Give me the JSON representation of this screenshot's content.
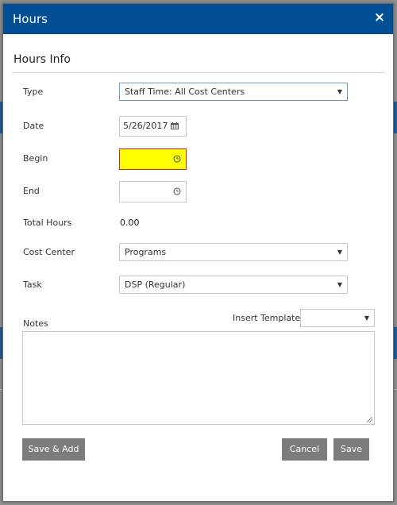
{
  "modal": {
    "title": "Hours",
    "close_label": "×",
    "section_title": "Hours Info"
  },
  "form": {
    "type": {
      "label": "Type",
      "value": "Staff Time: All Cost Centers"
    },
    "date": {
      "label": "Date",
      "value": "5/26/2017"
    },
    "begin": {
      "label": "Begin",
      "value": ""
    },
    "end": {
      "label": "End",
      "value": ""
    },
    "total_hours": {
      "label": "Total Hours",
      "value": "0.00"
    },
    "cost_center": {
      "label": "Cost Center",
      "value": "Programs"
    },
    "task": {
      "label": "Task",
      "value": "DSP (Regular)"
    },
    "notes": {
      "label": "Notes",
      "value": ""
    },
    "insert_template": {
      "label": "Insert Template",
      "value": ""
    }
  },
  "buttons": {
    "save_add": "Save & Add",
    "cancel": "Cancel",
    "save": "Save"
  },
  "icons": {
    "close": "close-icon",
    "calendar": "calendar-icon",
    "clock": "clock-icon",
    "caret": "chevron-down-icon"
  },
  "colors": {
    "header": "#034f96",
    "button": "#7c7c7c",
    "required_highlight": "#ffff00",
    "required_border": "#c62828"
  }
}
